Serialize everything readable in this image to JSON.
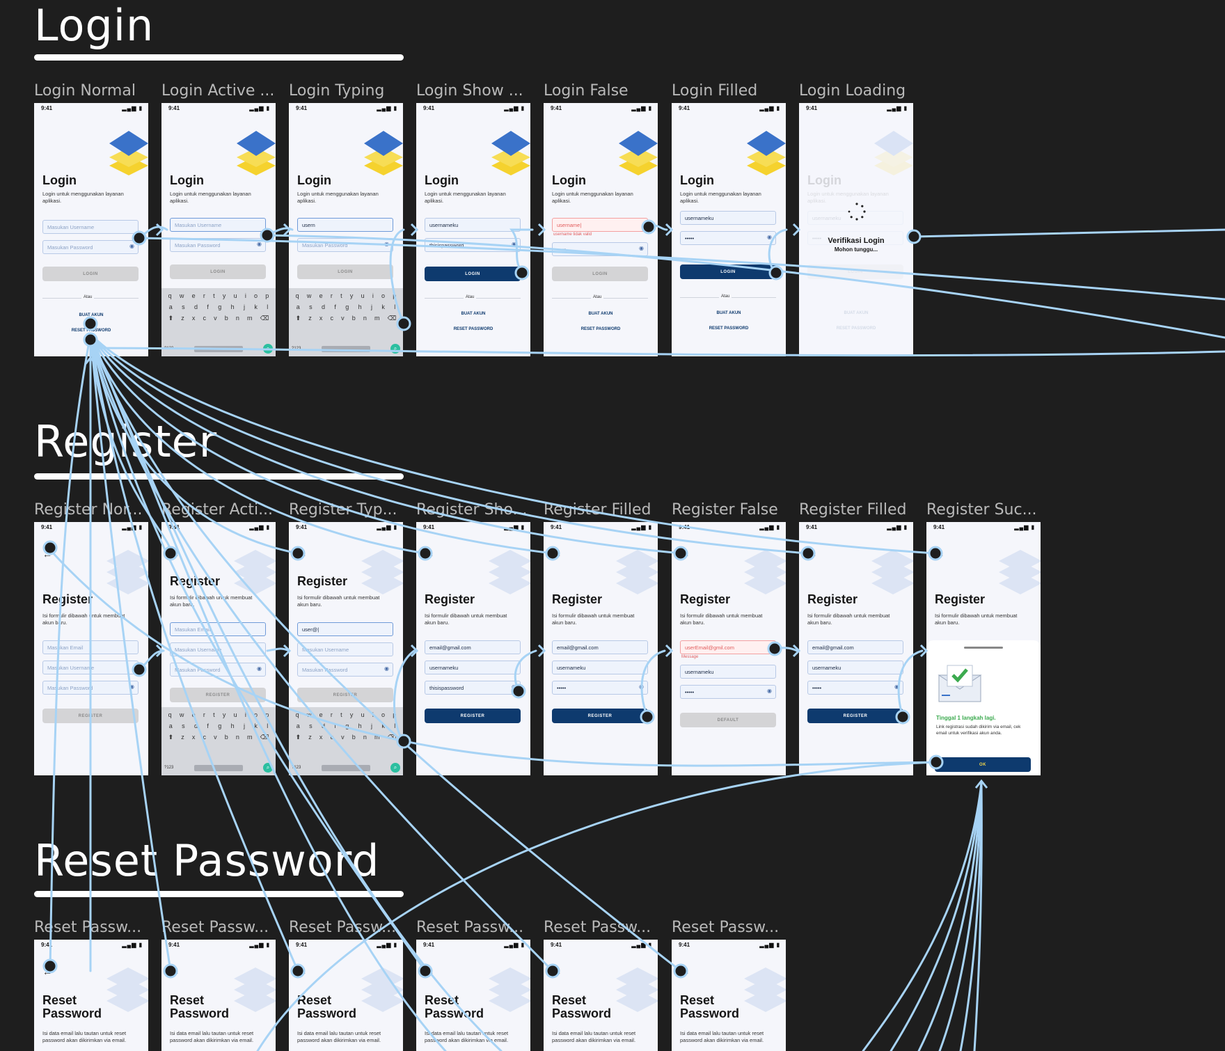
{
  "sections": {
    "login": "Login",
    "register": "Register",
    "reset": "Reset Password"
  },
  "status_time": "9:41",
  "login_frames": [
    {
      "label": "Login Normal"
    },
    {
      "label": "Login Active ..."
    },
    {
      "label": "Login Typing"
    },
    {
      "label": "Login Show ..."
    },
    {
      "label": "Login False"
    },
    {
      "label": "Login Filled"
    },
    {
      "label": "Login Loading"
    }
  ],
  "register_frames": [
    {
      "label": "Register Nor..."
    },
    {
      "label": "Register Acti..."
    },
    {
      "label": "Register Typ..."
    },
    {
      "label": "Register Sho..."
    },
    {
      "label": "Register Filled"
    },
    {
      "label": "Register False"
    },
    {
      "label": "Register Filled"
    },
    {
      "label": "Register Suc..."
    }
  ],
  "reset_frames": [
    {
      "label": "Reset Passw..."
    },
    {
      "label": "Reset Passw..."
    },
    {
      "label": "Reset Passw..."
    },
    {
      "label": "Reset Passw..."
    },
    {
      "label": "Reset Passw..."
    },
    {
      "label": "Reset Passw..."
    }
  ],
  "login_screen": {
    "title": "Login",
    "subtitle": "Login untuk menggunakan layanan aplikasi.",
    "username_placeholder": "Masukan Username",
    "password_placeholder": "Masukan Password",
    "typed_username": "usern",
    "username_value": "usernameku",
    "password_shown": "thisispassword",
    "password_masked": "•••••",
    "username_error_value": "username|",
    "error_message": "username tidak valid",
    "login_button": "LOGIN",
    "or_text": "Atau",
    "create_account": "BUAT AKUN",
    "reset_password": "RESET PASSWORD",
    "loading_title": "Verifikasi Login",
    "loading_sub": "Mohon tunggu..."
  },
  "register_screen": {
    "title": "Register",
    "subtitle": "Isi formulir dibawah untuk membuat akun baru.",
    "email_placeholder": "Masukan Email",
    "username_placeholder": "Masukan Username",
    "password_placeholder": "Masukan Password",
    "typed_email": "user@|",
    "email_value": "email@gmail.com",
    "error_email_value": "userEmail@gmil.com",
    "error_message": "Message",
    "username_value": "usernameku",
    "password_shown": "thisispassword",
    "password_masked": "•••••",
    "register_button": "REGISTER",
    "default_button": "DEFAULT",
    "success_title": "Tinggal 1 langkah lagi.",
    "success_text": "Link registrasi sudah dikirim via email, cek email untuk verifikasi akun anda.",
    "ok_button": "OK"
  },
  "reset_screen": {
    "title_line1": "Reset",
    "title_line2": "Password",
    "subtitle": "Isi data email lalu tautan untuk reset password akan dikirimkan via email."
  },
  "keyboard": {
    "row1": [
      "q",
      "w",
      "e",
      "r",
      "t",
      "y",
      "u",
      "i",
      "o",
      "p"
    ],
    "row2": [
      "a",
      "s",
      "d",
      "f",
      "g",
      "h",
      "j",
      "k",
      "l"
    ],
    "row3": [
      "z",
      "x",
      "c",
      "v",
      "b",
      "n",
      "m"
    ],
    "num_key": "?123"
  },
  "colors": {
    "canvas": "#1e1e1e",
    "wire": "#a7d3f5",
    "primary": "#0e3a6e",
    "logo_blue": "#3a72c9",
    "logo_yellow": "#f5d22e",
    "success_green": "#3caa4f"
  }
}
